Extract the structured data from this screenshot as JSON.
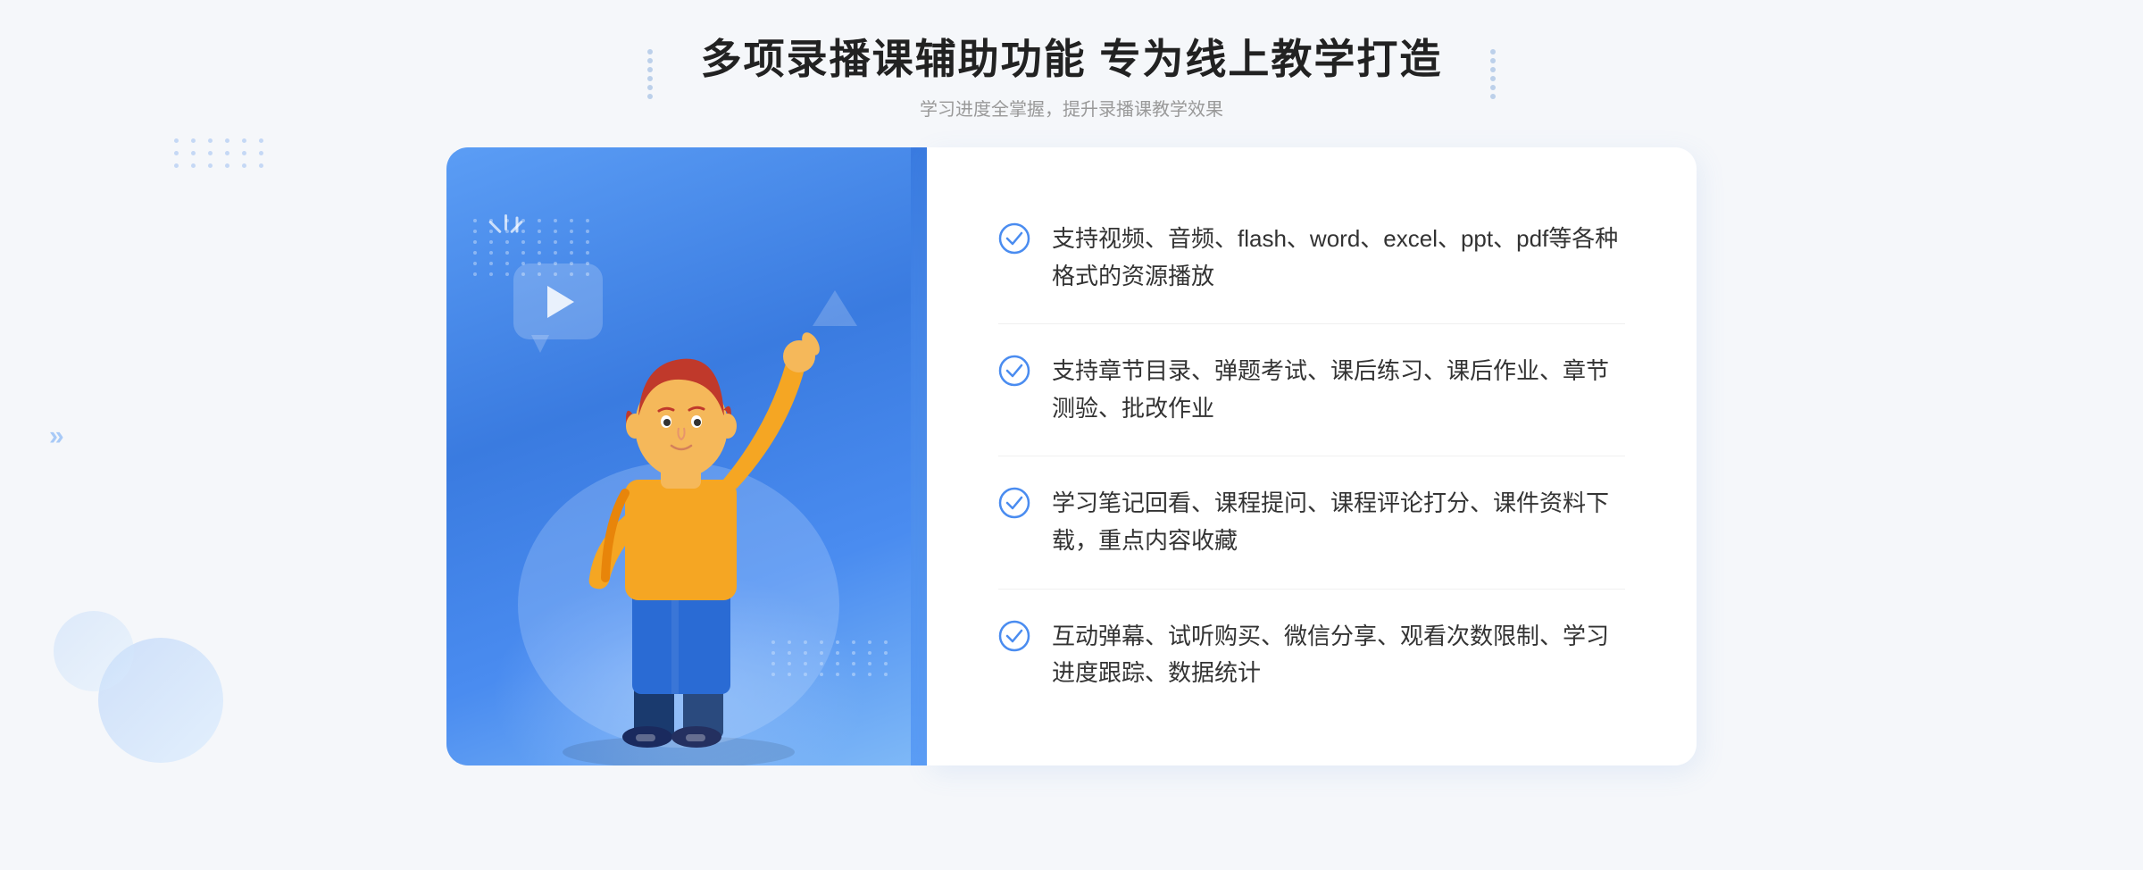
{
  "header": {
    "main_title": "多项录播课辅助功能 专为线上教学打造",
    "sub_title": "学习进度全掌握，提升录播课教学效果"
  },
  "features": [
    {
      "id": "feature-1",
      "text": "支持视频、音频、flash、word、excel、ppt、pdf等各种格式的资源播放"
    },
    {
      "id": "feature-2",
      "text": "支持章节目录、弹题考试、课后练习、课后作业、章节测验、批改作业"
    },
    {
      "id": "feature-3",
      "text": "学习笔记回看、课程提问、课程评论打分、课件资料下载，重点内容收藏"
    },
    {
      "id": "feature-4",
      "text": "互动弹幕、试听购买、微信分享、观看次数限制、学习进度跟踪、数据统计"
    }
  ],
  "icons": {
    "check": "check-circle-icon",
    "play": "play-icon",
    "chevron": "chevron-right-icon"
  },
  "colors": {
    "primary_blue": "#4a8cf0",
    "dark_blue": "#3a7be0",
    "light_blue": "#7eb8f7",
    "text_dark": "#222222",
    "text_medium": "#333333",
    "text_light": "#999999",
    "bg": "#f5f7fa",
    "white": "#ffffff",
    "check_color": "#4a8cf0"
  }
}
